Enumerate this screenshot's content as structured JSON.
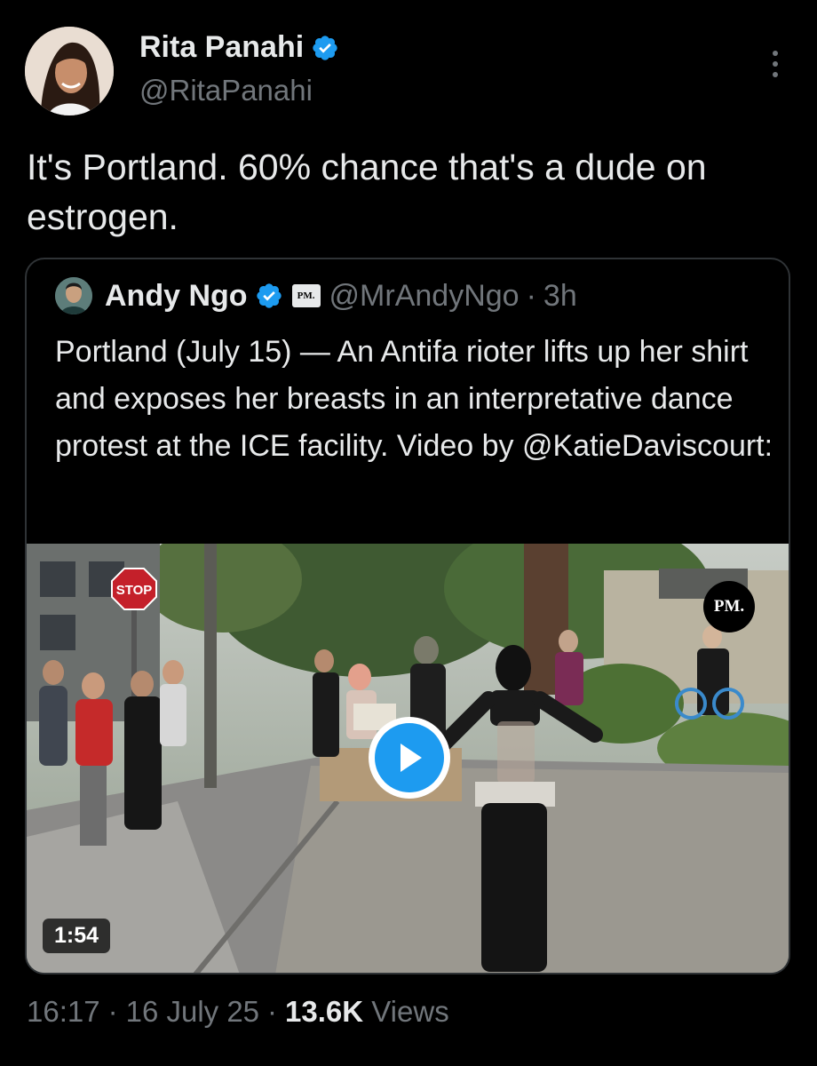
{
  "tweet": {
    "author": {
      "display_name": "Rita Panahi",
      "handle": "@RitaPanahi",
      "verified": true
    },
    "text": "It's Portland. 60% chance that's a dude on estrogen.",
    "timestamp_time": "16:17",
    "timestamp_date": "16 July 25",
    "views_count": "13.6K",
    "views_label": "Views",
    "separator": "·"
  },
  "quoted": {
    "author": {
      "display_name": "Andy Ngo",
      "handle": "@MrAndyNgo",
      "affiliate_badge": "PM.",
      "verified": true
    },
    "time_ago": "3h",
    "separator": "·",
    "text": "Portland (July 15) — An Antifa rioter lifts up her shirt and exposes her breasts in an interpretative dance protest at the ICE facility. Video by @KatieDaviscourt:",
    "media": {
      "type": "video",
      "duration": "1:54",
      "watermark": "PM.",
      "sign_text": "STOP"
    }
  },
  "icons": {
    "verified": "verified-badge-icon",
    "more": "more-options-icon",
    "play": "play-icon"
  },
  "colors": {
    "background": "#000000",
    "text_primary": "#e7e9ea",
    "text_secondary": "#71767b",
    "accent": "#1d9bf0",
    "border": "#2f3336"
  }
}
